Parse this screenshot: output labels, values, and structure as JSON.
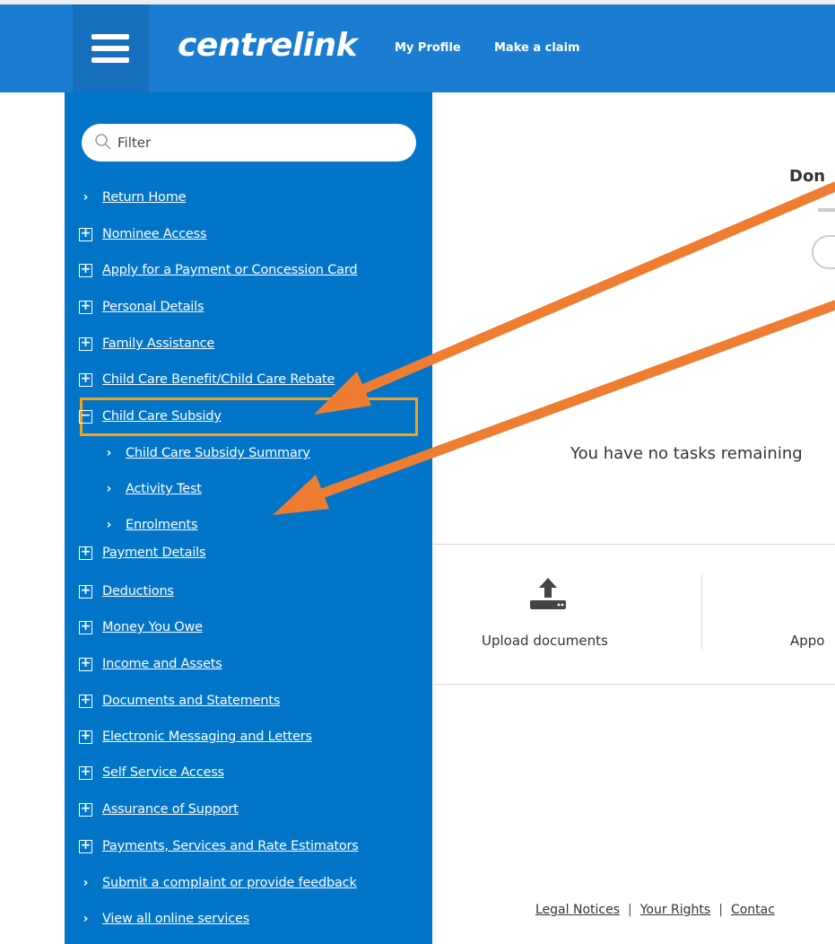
{
  "header": {
    "logo": "centrelink",
    "nav": [
      "My Profile",
      "Make a claim"
    ]
  },
  "sidebar": {
    "filter_placeholder": "Filter",
    "items": [
      {
        "label": "Return Home",
        "marker": "chevron"
      },
      {
        "label": "Nominee Access",
        "marker": "plus"
      },
      {
        "label": "Apply for a Payment or Concession Card",
        "marker": "plus"
      },
      {
        "label": "Personal Details",
        "marker": "plus"
      },
      {
        "label": "Family Assistance",
        "marker": "plus"
      },
      {
        "label": "Child Care Benefit/Child Care Rebate",
        "marker": "plus"
      },
      {
        "label": "Child Care Subsidy",
        "marker": "minus",
        "expanded": true,
        "highlighted": true
      },
      {
        "label": "Child Care Subsidy Summary",
        "marker": "chevron",
        "sub": true
      },
      {
        "label": "Activity Test",
        "marker": "chevron",
        "sub": true
      },
      {
        "label": "Enrolments",
        "marker": "chevron",
        "sub": true
      },
      {
        "label": "Payment Details",
        "marker": "plus"
      },
      {
        "label": "Deductions",
        "marker": "plus"
      },
      {
        "label": "Money You Owe",
        "marker": "plus"
      },
      {
        "label": "Income and Assets",
        "marker": "plus"
      },
      {
        "label": "Documents and Statements",
        "marker": "plus"
      },
      {
        "label": "Electronic Messaging and Letters",
        "marker": "plus"
      },
      {
        "label": "Self Service Access",
        "marker": "plus"
      },
      {
        "label": "Assurance of Support",
        "marker": "plus"
      },
      {
        "label": "Payments, Services and Rate Estimators",
        "marker": "plus"
      },
      {
        "label": "Submit a complaint or provide feedback",
        "marker": "chevron"
      },
      {
        "label": "View all online services",
        "marker": "chevron"
      }
    ]
  },
  "main": {
    "done_title": "Don",
    "tasks_message": "You have no tasks remaining",
    "quick_links": [
      {
        "label": "Upload documents",
        "icon": "upload-icon"
      },
      {
        "label": "Appo",
        "icon": ""
      }
    ]
  },
  "footer": {
    "links": [
      "Legal Notices",
      "Your Rights",
      "Contac"
    ]
  },
  "colors": {
    "header_blue": "#1a7dd1",
    "sidebar_blue": "#0275c9",
    "highlight_orange": "#f4a218",
    "arrow_orange": "#ee7d31"
  }
}
